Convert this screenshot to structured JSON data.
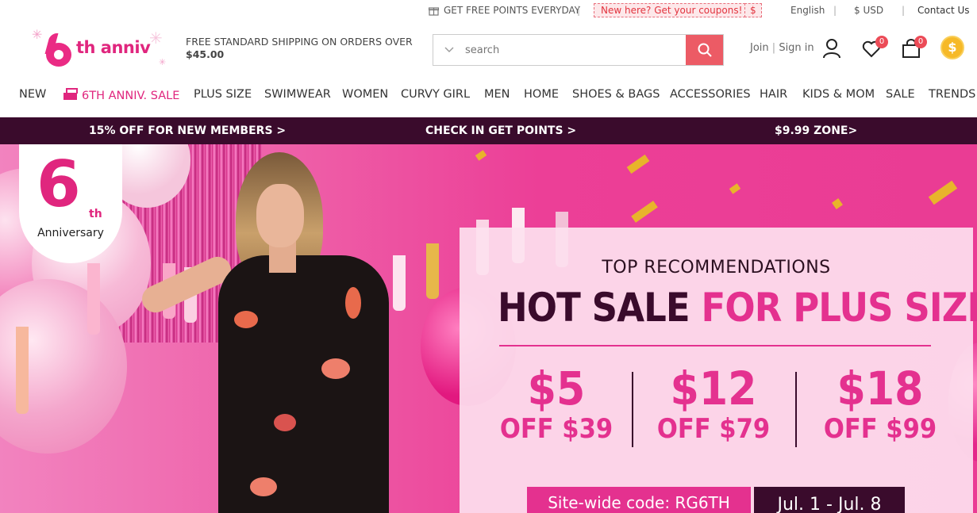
{
  "topbar": {
    "points": "GET FREE POINTS EVERYDAY",
    "coupon": "New here? Get your coupons!",
    "coupon_symbol": "$",
    "language": "English",
    "currency": "$ USD",
    "contact": "Contact Us"
  },
  "header": {
    "logo_text": "th anniv",
    "shipping_line1": "FREE STANDARD SHIPPING ON ORDERS OVER",
    "shipping_line2": "$45.00",
    "search_placeholder": "search",
    "join": "Join",
    "divider": "|",
    "sign_in": "Sign in",
    "wishlist_count": "0",
    "cart_count": "0",
    "coin_symbol": "$"
  },
  "nav": {
    "items": [
      "NEW",
      "6TH ANNIV. SALE",
      "PLUS SIZE",
      "SWIMWEAR",
      "WOMEN",
      "CURVY GIRL",
      "MEN",
      "HOME",
      "SHOES & BAGS",
      "ACCESSORIES",
      "HAIR",
      "KIDS & MOM",
      "SALE",
      "TRENDS"
    ]
  },
  "promobar": {
    "left": "15% OFF FOR NEW MEMBERS >",
    "center": "CHECK IN GET POINTS >",
    "right": "$9.99 ZONE>"
  },
  "hero": {
    "badge_number": "6",
    "badge_suffix": "th",
    "badge_label": "Anniversary",
    "kicker": "TOP RECOMMENDATIONS",
    "headline_dark": "HOT SALE",
    "headline_pink": "FOR PLUS SIZE",
    "deals": [
      {
        "amount": "$5",
        "threshold": "OFF $39"
      },
      {
        "amount": "$12",
        "threshold": "OFF $79"
      },
      {
        "amount": "$18",
        "threshold": "OFF $99"
      }
    ],
    "code": "Site-wide code: RG6TH",
    "dates": "Jul. 1 - Jul. 8"
  },
  "colors": {
    "brand_pink": "#e0267e",
    "dark_plum": "#3a0b2c",
    "search_button": "#ec5b65"
  }
}
